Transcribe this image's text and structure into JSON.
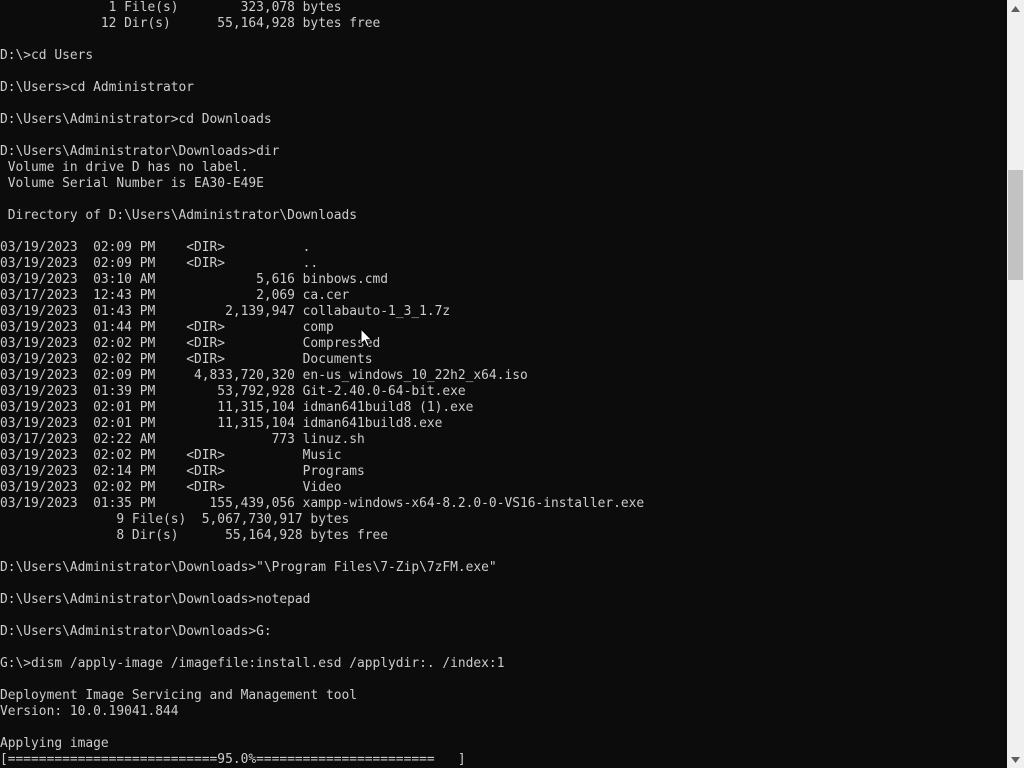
{
  "terminal": {
    "lines": [
      "              1 File(s)        323,078 bytes",
      "             12 Dir(s)      55,164,928 bytes free",
      "",
      "D:\\>cd Users",
      "",
      "D:\\Users>cd Administrator",
      "",
      "D:\\Users\\Administrator>cd Downloads",
      "",
      "D:\\Users\\Administrator\\Downloads>dir",
      " Volume in drive D has no label.",
      " Volume Serial Number is EA30-E49E",
      "",
      " Directory of D:\\Users\\Administrator\\Downloads",
      "",
      "03/19/2023  02:09 PM    <DIR>          .",
      "03/19/2023  02:09 PM    <DIR>          ..",
      "03/19/2023  03:10 AM             5,616 binbows.cmd",
      "03/17/2023  12:43 PM             2,069 ca.cer",
      "03/19/2023  01:43 PM         2,139,947 collabauto-1_3_1.7z",
      "03/19/2023  01:44 PM    <DIR>          comp",
      "03/19/2023  02:02 PM    <DIR>          Compressed",
      "03/19/2023  02:02 PM    <DIR>          Documents",
      "03/19/2023  02:09 PM     4,833,720,320 en-us_windows_10_22h2_x64.iso",
      "03/19/2023  01:39 PM        53,792,928 Git-2.40.0-64-bit.exe",
      "03/19/2023  02:01 PM        11,315,104 idman641build8 (1).exe",
      "03/19/2023  02:01 PM        11,315,104 idman641build8.exe",
      "03/17/2023  02:22 AM               773 linuz.sh",
      "03/19/2023  02:02 PM    <DIR>          Music",
      "03/19/2023  02:14 PM    <DIR>          Programs",
      "03/19/2023  02:02 PM    <DIR>          Video",
      "03/19/2023  01:35 PM       155,439,056 xampp-windows-x64-8.2.0-0-VS16-installer.exe",
      "               9 File(s)  5,067,730,917 bytes",
      "               8 Dir(s)      55,164,928 bytes free",
      "",
      "D:\\Users\\Administrator\\Downloads>\"\\Program Files\\7-Zip\\7zFM.exe\"",
      "",
      "D:\\Users\\Administrator\\Downloads>notepad",
      "",
      "D:\\Users\\Administrator\\Downloads>G:",
      "",
      "G:\\>dism /apply-image /imagefile:install.esd /applydir:. /index:1",
      "",
      "Deployment Image Servicing and Management tool",
      "Version: 10.0.19041.844",
      "",
      "Applying image",
      "[===========================95.0%=======================   ]"
    ],
    "progress_percent": 95.0,
    "colors": {
      "background": "#0c0c0c",
      "foreground": "#cccccc",
      "scrollbar_track": "#f0f0f0",
      "scrollbar_thumb": "#c2c2c2"
    },
    "scrollbar": {
      "up_icon": "scroll-up-arrow-icon",
      "down_icon": "scroll-down-arrow-icon"
    },
    "cursor_icon": "mouse-pointer-icon"
  }
}
